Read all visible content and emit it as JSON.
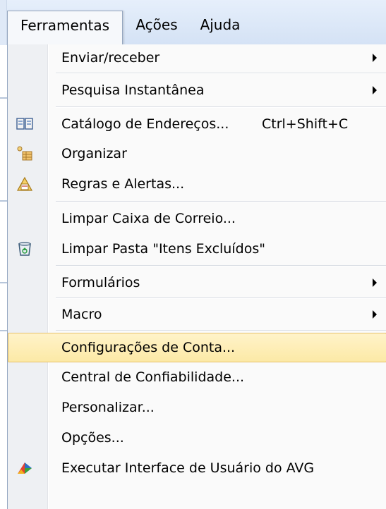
{
  "menubar": {
    "items": [
      {
        "label": "Ferramentas",
        "active": true
      },
      {
        "label": "Ações",
        "active": false
      },
      {
        "label": "Ajuda",
        "active": false
      }
    ]
  },
  "menu": {
    "items": [
      {
        "label": "Enviar/receber",
        "submenu": true
      },
      {
        "label": "Pesquisa Instantânea",
        "submenu": true
      },
      {
        "label": "Catálogo de Endereços...",
        "shortcut": "Ctrl+Shift+C",
        "icon": "address-book-icon"
      },
      {
        "label": "Organizar",
        "icon": "organize-icon"
      },
      {
        "label": "Regras e Alertas...",
        "icon": "rules-alerts-icon"
      },
      {
        "label": "Limpar Caixa de Correio..."
      },
      {
        "label": "Limpar Pasta \"Itens Excluídos\"",
        "icon": "recycle-bin-icon"
      },
      {
        "label": "Formulários",
        "submenu": true
      },
      {
        "label": "Macro",
        "submenu": true
      },
      {
        "label": "Configurações de Conta...",
        "highlighted": true
      },
      {
        "label": "Central de Confiabilidade..."
      },
      {
        "label": "Personalizar..."
      },
      {
        "label": "Opções..."
      },
      {
        "label": "Executar Interface de Usuário do AVG",
        "icon": "avg-icon"
      }
    ]
  },
  "colors": {
    "highlight": "#fce9a6",
    "menubar": "#d4e2f5",
    "gutter": "#eef0f3"
  }
}
